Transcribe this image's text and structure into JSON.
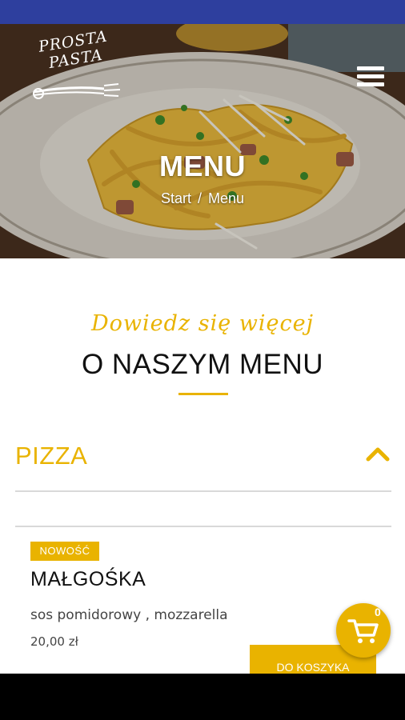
{
  "logo": {
    "text": "PROSTA PASTA"
  },
  "hero": {
    "title": "MENU"
  },
  "breadcrumb": {
    "start": "Start",
    "separator": "/",
    "current": "Menu"
  },
  "section": {
    "subtitle": "Dowiedz się więcej",
    "title": "O NASZYM MENU"
  },
  "category": {
    "label": "PIZZA",
    "expanded": true
  },
  "item": {
    "badge": "NOWOŚĆ",
    "name": "MAŁGOŚKA",
    "description": "sos pomidorowy , mozzarella",
    "price": "20,00 zł",
    "add_label": "DO KOSZYKA"
  },
  "cart": {
    "count": "0"
  },
  "icons": {
    "menu": "hamburger-menu-icon",
    "chevron": "chevron-up-icon",
    "cart": "shopping-cart-icon",
    "logo_art": "fork-icon"
  },
  "colors": {
    "accent": "#e9b300",
    "statusbar": "#2e3f9e",
    "text": "#111111"
  }
}
